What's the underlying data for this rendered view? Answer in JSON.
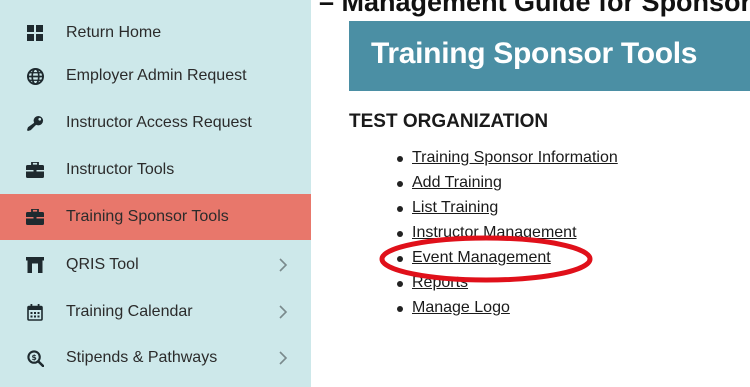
{
  "top_heading": "Training Sponsor Tools – Management Guide for Sponsors",
  "sidebar": {
    "items": [
      {
        "label": "Return Home",
        "icon": "grid-icon",
        "active": false,
        "chevron": false
      },
      {
        "label": "Employer Admin Request",
        "icon": "globe-icon",
        "active": false,
        "chevron": false
      },
      {
        "label": "Instructor Access Request",
        "icon": "key-icon",
        "active": false,
        "chevron": false
      },
      {
        "label": "Instructor Tools",
        "icon": "briefcase-icon",
        "active": false,
        "chevron": false
      },
      {
        "label": "Training Sponsor Tools",
        "icon": "briefcase-icon",
        "active": true,
        "chevron": false
      },
      {
        "label": "QRIS Tool",
        "icon": "archway-icon",
        "active": false,
        "chevron": true
      },
      {
        "label": "Training Calendar",
        "icon": "calendar-icon",
        "active": false,
        "chevron": true
      },
      {
        "label": "Stipends & Pathways",
        "icon": "search-dollar-icon",
        "active": false,
        "chevron": true
      }
    ]
  },
  "main": {
    "title": "Training Sponsor Tools",
    "organization": "TEST ORGANIZATION",
    "links": [
      "Training Sponsor Information",
      "Add Training",
      "List Training",
      "Instructor Management",
      "Event Management",
      "Reports",
      "Manage Logo"
    ]
  },
  "colors": {
    "sidebar_bg": "#cde8ea",
    "active_item_bg": "#e8776b",
    "title_box_bg": "#4b8fa4",
    "highlight_ellipse": "#e0101a"
  }
}
